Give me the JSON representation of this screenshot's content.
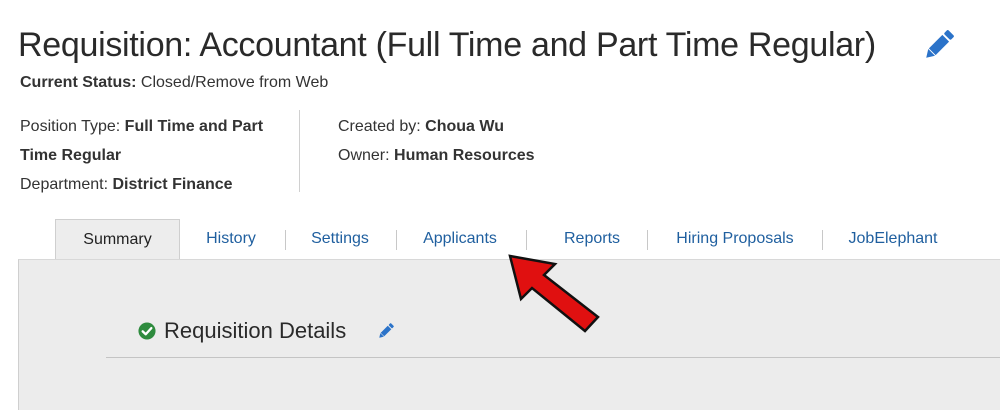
{
  "header": {
    "title": "Requisition: Accountant (Full Time and Part Time Regular)",
    "edit_icon": "pencil-icon",
    "status_label": "Current Status:",
    "status_value": "Closed/Remove from Web"
  },
  "meta": {
    "position_type_label": "Position Type:",
    "position_type_value": "Full Time and Part Time Regular",
    "department_label": "Department:",
    "department_value": "District Finance",
    "created_by_label": "Created by:",
    "created_by_value": "Choua Wu",
    "owner_label": "Owner:",
    "owner_value": "Human Resources"
  },
  "tabs": [
    {
      "label": "Summary",
      "active": true
    },
    {
      "label": "History"
    },
    {
      "label": "Settings"
    },
    {
      "label": "Applicants"
    },
    {
      "label": "Reports"
    },
    {
      "label": "Hiring Proposals"
    },
    {
      "label": "JobElephant"
    }
  ],
  "section": {
    "title": "Requisition Details",
    "status_icon": "check-circle-icon",
    "edit_icon": "pencil-icon"
  },
  "annotation": {
    "icon": "red-arrow-icon",
    "target": "Applicants"
  },
  "colors": {
    "accent": "#2b73c9",
    "link": "#1f5f9f",
    "success": "#2e8b3e",
    "arrow": "#e01010",
    "panel_bg": "#ececec"
  }
}
